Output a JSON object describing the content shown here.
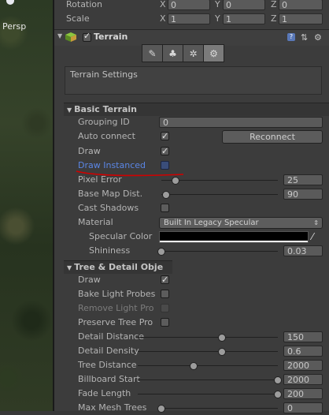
{
  "scene": {
    "view_label": "Persp"
  },
  "transform": {
    "rotation": {
      "label": "Rotation",
      "x_axis": "X",
      "x": "0",
      "y_axis": "Y",
      "y": "0",
      "z_axis": "Z",
      "z": "0"
    },
    "scale": {
      "label": "Scale",
      "x_axis": "X",
      "x": "1",
      "y_axis": "Y",
      "y": "1",
      "z_axis": "Z",
      "z": "1"
    }
  },
  "component": {
    "name": "Terrain",
    "enabled": true
  },
  "tabs": [
    {
      "icon": "paint-brush-icon",
      "glyph": "✎"
    },
    {
      "icon": "tree-icon",
      "glyph": "♣"
    },
    {
      "icon": "detail-icon",
      "glyph": "✲"
    },
    {
      "icon": "settings-gear-icon",
      "glyph": "⚙"
    }
  ],
  "settings_box": {
    "title": "Terrain Settings"
  },
  "basic": {
    "header": "Basic Terrain",
    "grouping_label": "Grouping ID",
    "grouping_value": "0",
    "auto_connect_label": "Auto connect",
    "auto_connect": true,
    "reconnect_label": "Reconnect",
    "draw_label": "Draw",
    "draw": true,
    "draw_instanced_label": "Draw Instanced",
    "draw_instanced": false,
    "pixel_error_label": "Pixel Error",
    "pixel_error": "25",
    "pixel_error_fraction": 0.12,
    "base_map_label": "Base Map Dist.",
    "base_map": "90",
    "base_map_fraction": 0.04,
    "cast_shadows_label": "Cast Shadows",
    "cast_shadows": false,
    "material_label": "Material",
    "material_value": "Built In Legacy Specular",
    "specular_label": "Specular Color",
    "specular_color": "#000000",
    "shininess_label": "Shininess",
    "shininess": "0.03",
    "shininess_fraction": 0.0
  },
  "tree": {
    "header": "Tree & Detail Obje",
    "draw_label": "Draw",
    "draw": true,
    "bake_label": "Bake Light Probes",
    "bake": false,
    "remove_label": "Remove Light Pro",
    "remove": false,
    "preserve_label": "Preserve Tree Pro",
    "preserve": false,
    "detail_distance_label": "Detail Distance",
    "detail_distance": "150",
    "detail_distance_fraction": 0.6,
    "detail_density_label": "Detail Density",
    "detail_density": "0.6",
    "detail_density_fraction": 0.6,
    "tree_distance_label": "Tree Distance",
    "tree_distance": "2000",
    "tree_distance_fraction": 0.4,
    "billboard_label": "Billboard Start",
    "billboard": "2000",
    "billboard_fraction": 1.0,
    "fade_label": "Fade Length",
    "fade": "200",
    "fade_fraction": 1.0,
    "max_mesh_label": "Max Mesh Trees",
    "max_mesh": "0",
    "max_mesh_fraction": 0.0
  },
  "colors": {
    "draw_instanced_label": "#5b86e5",
    "annotation_stroke": "#d00000"
  }
}
